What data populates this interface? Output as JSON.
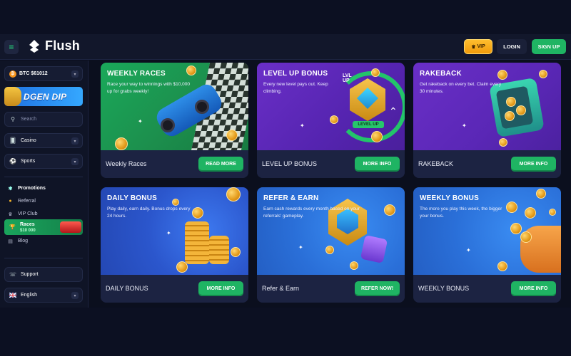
{
  "header": {
    "logo_text": "Flush",
    "vip_label": "VIP",
    "login_label": "LOGIN",
    "signup_label": "SIGN UP"
  },
  "sidebar": {
    "balance_label": "BTC $61012",
    "promo_banner_text": "DGEN DIP",
    "search_placeholder": "Search",
    "casino_label": "Casino",
    "sports_label": "Sports",
    "nav": {
      "promotions": "Promotions",
      "referral": "Referral",
      "vip_club": "VIP Club",
      "races": "Races",
      "races_amount": "$10 000",
      "blog": "Blog"
    },
    "support_label": "Support",
    "language_label": "English"
  },
  "cards": [
    {
      "title": "WEEKLY RACES",
      "description": "Race your way to winnings with $10,000 up for grabs weekly!",
      "footer_label": "Weekly Races",
      "button": "READ MORE"
    },
    {
      "title": "LEVEL UP BONUS",
      "description": "Every new level pays out. Keep climbing.",
      "footer_label": "LEVEL UP BONUS",
      "button": "MORE INFO",
      "badge_top": "LVL UP",
      "badge_ribbon": "LEVEL UP"
    },
    {
      "title": "RAKEBACK",
      "description": "Get rakeback on every bet. Claim every 30 minutes.",
      "footer_label": "RAKEBACK",
      "button": "MORE INFO"
    },
    {
      "title": "DAILY BONUS",
      "description": "Play daily, earn daily. Bonus drops every 24 hours.",
      "footer_label": "DAILY BONUS",
      "button": "MORE INFO"
    },
    {
      "title": "REFER & EARN",
      "description": "Earn cash rewards every month based on your referrals' gameplay.",
      "footer_label": "Refer & Earn",
      "button": "REFER NOW!"
    },
    {
      "title": "WEEKLY BONUS",
      "description": "The more you play this week, the bigger your bonus.",
      "footer_label": "WEEKLY BONUS",
      "button": "MORE INFO"
    }
  ],
  "colors": {
    "accent_green": "#1fb463",
    "vip_gold": "#f7a51c",
    "background": "#0b0f1e"
  }
}
